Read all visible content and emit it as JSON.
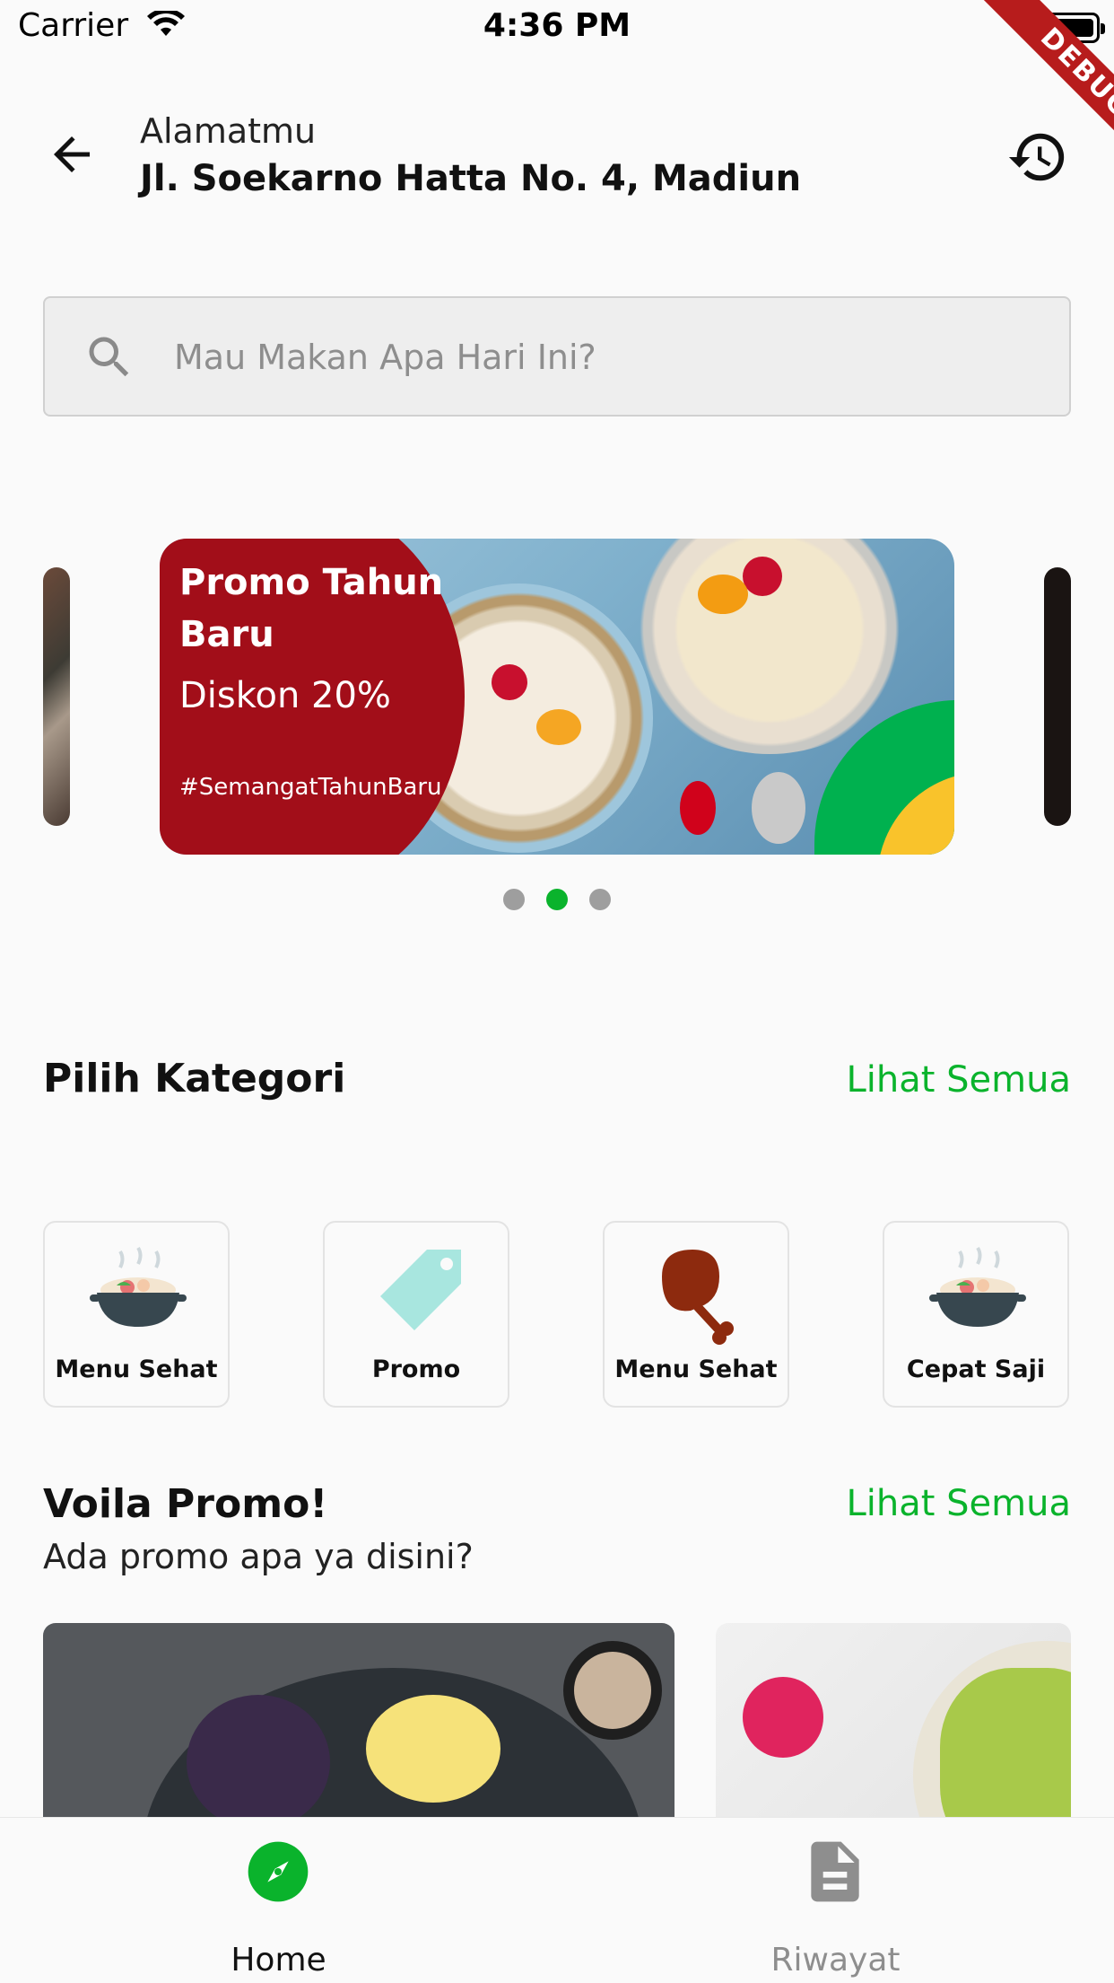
{
  "status_bar": {
    "carrier": "Carrier",
    "time": "4:36 PM",
    "debug_label": "DEBUG"
  },
  "header": {
    "address_label": "Alamatmu",
    "address_value": "Jl. Soekarno Hatta No. 4, Madiun",
    "back_icon": "arrow-left-icon",
    "history_icon": "history-icon"
  },
  "search": {
    "placeholder": "Mau Makan Apa Hari Ini?",
    "value": "",
    "icon": "search-icon"
  },
  "banner": {
    "title": "Promo Tahun Baru",
    "discount": "Diskon 20%",
    "hashtag": "#SemangatTahunBaru",
    "brand_color": "#a20e19",
    "active_dot": 2,
    "dot_count": 3
  },
  "categories": {
    "title": "Pilih Kategori",
    "see_all": "Lihat Semua",
    "items": [
      {
        "label": "Menu Sehat",
        "icon": "cooking-pot-icon"
      },
      {
        "label": "Promo",
        "icon": "price-tag-icon"
      },
      {
        "label": "Menu Sehat",
        "icon": "chicken-leg-icon"
      },
      {
        "label": "Cepat Saji",
        "icon": "cooking-pot-icon"
      }
    ]
  },
  "promo_section": {
    "title": "Voila Promo!",
    "subtitle": "Ada promo apa ya disini?",
    "see_all": "Lihat Semua"
  },
  "bottom_nav": {
    "items": [
      {
        "label": "Home",
        "icon": "compass-icon",
        "active": true
      },
      {
        "label": "Riwayat",
        "icon": "document-icon",
        "active": false
      }
    ]
  },
  "colors": {
    "accent": "#0ab32c",
    "banner_red": "#a20e19",
    "inactive": "#9e9e9e"
  }
}
